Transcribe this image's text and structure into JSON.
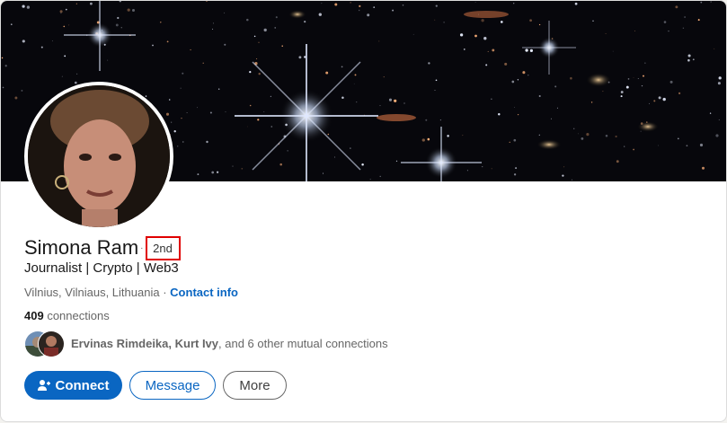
{
  "profile": {
    "name": "Simona Ram",
    "degree": "2nd",
    "headline": "Journalist | Crypto | Web3",
    "location": "Vilnius, Vilniaus, Lithuania",
    "location_sep": "·",
    "contact_info": "Contact info",
    "connections_count": "409",
    "connections_label": "connections",
    "mutual": {
      "names": "Ervinas Rimdeika, Kurt Ivy",
      "rest": ", and 6 other mutual connections"
    }
  },
  "actions": {
    "connect": "Connect",
    "message": "Message",
    "more": "More"
  },
  "icons": {
    "connect": "person-add-icon"
  },
  "colors": {
    "accent": "#0a66c2",
    "highlight_box": "#e00000"
  }
}
